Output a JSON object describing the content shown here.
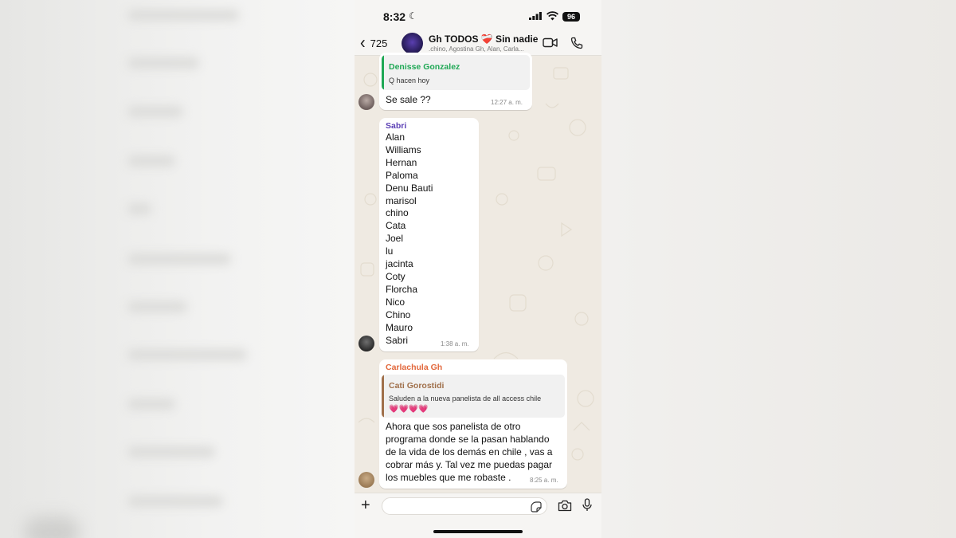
{
  "status_bar": {
    "time": "8:32",
    "battery": "96"
  },
  "header": {
    "back_count": "725",
    "group_title": "Gh TODOS ❤️‍🩹 Sin nadie",
    "members_preview": ".chino, Agostina Gh, Alan, Carla..."
  },
  "messages": [
    {
      "quote": {
        "name": "Denisse Gonzalez",
        "text": "Q hacen hoy",
        "color": "#1fa855"
      },
      "text": "Se sale ??",
      "time": "12:27 a. m."
    },
    {
      "sender": "Sabri",
      "sender_color": "#5b3fb5",
      "lines": [
        "Alan",
        "Williams",
        "Hernan",
        "Paloma",
        "Denu Bauti",
        "marisol",
        "chino",
        "Cata",
        "Joel",
        "lu",
        "jacinta",
        "Coty",
        "Florcha",
        "Nico",
        "Chino",
        "Mauro",
        "Sabri"
      ],
      "time": "1:38 a. m."
    },
    {
      "sender": "Carlachula Gh",
      "sender_color": "#e2683c",
      "quote": {
        "name": "Cati Gorostidi",
        "text": "Saluden a la nueva panelista de all access chile",
        "emoji": "💗💗💗💗",
        "color": "#a0704b"
      },
      "lines": [
        "Ahora que sos panelista de otro",
        "programa donde se la pasan hablando",
        "de la vida de los demás en chile , vas a",
        "cobrar más y. Tal vez me puedas pagar",
        "los muebles que me robaste ."
      ],
      "time": "8:25 a. m."
    }
  ],
  "icons": [
    "moon-icon",
    "signal-icon",
    "wifi-icon",
    "chevron-left-icon",
    "video-call-icon",
    "phone-call-icon",
    "plus-icon",
    "sticker-icon",
    "camera-icon",
    "microphone-icon"
  ]
}
